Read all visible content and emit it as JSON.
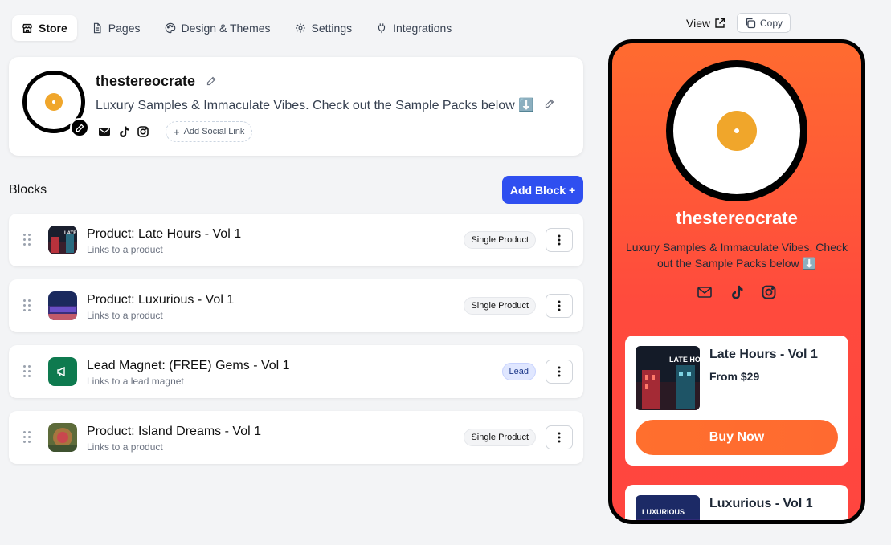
{
  "nav": {
    "tabs": [
      {
        "label": "Store",
        "icon": "store-icon",
        "active": true
      },
      {
        "label": "Pages",
        "icon": "page-icon",
        "active": false
      },
      {
        "label": "Design & Themes",
        "icon": "palette-icon",
        "active": false
      },
      {
        "label": "Settings",
        "icon": "gear-icon",
        "active": false
      },
      {
        "label": "Integrations",
        "icon": "plug-icon",
        "active": false
      }
    ]
  },
  "profile": {
    "name": "thestereocrate",
    "bio": "Luxury Samples & Immaculate Vibes. Check out the Sample Packs below ⬇️",
    "add_social_label": "Add Social Link",
    "socials": [
      "mail-icon",
      "tiktok-icon",
      "instagram-icon"
    ]
  },
  "blocks": {
    "title": "Blocks",
    "add_label": "Add Block +",
    "items": [
      {
        "title": "Product: Late Hours - Vol 1",
        "subtitle": "Links to a product",
        "badge": "Single Product"
      },
      {
        "title": "Product: Luxurious - Vol 1",
        "subtitle": "Links to a product",
        "badge": "Single Product"
      },
      {
        "title": "Lead Magnet: (FREE) Gems - Vol 1",
        "subtitle": "Links to a lead magnet",
        "badge": "Lead"
      },
      {
        "title": "Product: Island Dreams - Vol 1",
        "subtitle": "Links to a product",
        "badge": "Single Product"
      }
    ]
  },
  "preview": {
    "view_label": "View",
    "copy_label": "Copy",
    "name": "thestereocrate",
    "bio": "Luxury Samples & Immaculate Vibes. Check out the Sample Packs below ⬇️",
    "cards": [
      {
        "title": "Late Hours - Vol 1",
        "price": "From $29",
        "button": "Buy Now",
        "thumb_text": "LATE HOURS"
      },
      {
        "title": "Luxurious - Vol 1",
        "thumb_text": "LUXURIOUS"
      }
    ]
  },
  "colors": {
    "accent": "#2f4ff0",
    "phone_gradient_top": "#ff6b30",
    "phone_gradient_bottom": "#ff453f",
    "record_center": "#f0a62b",
    "lead_icon_bg": "#0e7a4f"
  }
}
